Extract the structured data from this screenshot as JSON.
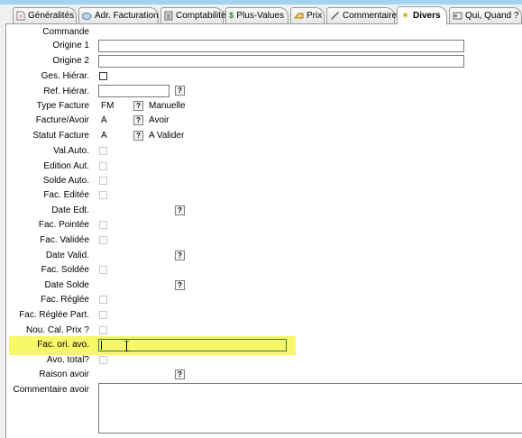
{
  "tabs": [
    {
      "label": "Généralités",
      "icon": "document-icon"
    },
    {
      "label": "Adr. Facturation",
      "icon": "address-icon"
    },
    {
      "label": "Comptabilité",
      "icon": "ledger-icon"
    },
    {
      "label": "Plus-Values",
      "icon": "dollar-icon"
    },
    {
      "label": "Prix",
      "icon": "price-icon"
    },
    {
      "label": "Commentaire",
      "icon": "pencil-icon"
    },
    {
      "label": "Divers",
      "icon": "star-icon",
      "active": true
    },
    {
      "label": "Qui, Quand ?",
      "icon": "card-icon"
    }
  ],
  "form": {
    "commande": "Commande",
    "origine1": "Origine 1",
    "origine2": "Origine 2",
    "ges_hierar": "Ges. Hiérar.",
    "ref_hierar": "Ref. Hiérar.",
    "type_facture": {
      "label": "Type Facture",
      "code": "FM",
      "desc": "Manuelle"
    },
    "facture_avoir": {
      "label": "Facture/Avoir",
      "code": "A",
      "desc": "Avoir"
    },
    "statut_facture": {
      "label": "Statut Facture",
      "code": "A",
      "desc": "A Valider"
    },
    "val_auto": "Val.Auto.",
    "edition_aut": "Edition Aut.",
    "solde_auto": "Solde Auto.",
    "fac_editee": "Fac. Editée",
    "date_edt": "Date Edt.",
    "fac_pointee": "Fac. Pointée",
    "fac_validee": "Fac. Validée",
    "date_valid": "Date Valid.",
    "fac_soldee": "Fac. Soldée",
    "date_solde": "Date Solde",
    "fac_reglee": "Fac. Réglée",
    "fac_reglee_part": "Fac. Réglée Part.",
    "nou_cal_prix": "Nou. Cal. Prix ?",
    "fac_ori_avo": "Fac. ori. avo.",
    "avo_total": "Avo. total?",
    "raison_avoir": "Raison avoir",
    "commentaire_avoir": "Commentaire avoir"
  },
  "lookup_button": "?",
  "colors": {
    "highlight": "#f7f76a",
    "tab_strip": "#9fd6ee"
  }
}
